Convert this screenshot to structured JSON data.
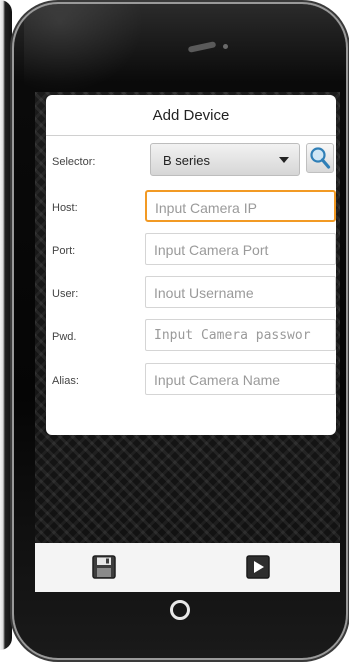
{
  "dialog": {
    "title": "Add Device",
    "selector_label": "Selector:",
    "selector_value": "B series",
    "host_label": "Host:",
    "host_placeholder": "Input Camera IP",
    "port_label": "Port:",
    "port_placeholder": "Input Camera Port",
    "user_label": "User:",
    "user_placeholder": "Inout Username",
    "pwd_label": "Pwd.",
    "pwd_placeholder": "Input Camera passwor",
    "alias_label": "Alias:",
    "alias_placeholder": "Input Camera Name"
  },
  "toolbar": {
    "save_icon": "save-icon",
    "play_icon": "play-icon"
  },
  "colors": {
    "focus_border": "#f29a24",
    "screen_background": "#111111",
    "bottom_bar": "#f4f4f4"
  }
}
